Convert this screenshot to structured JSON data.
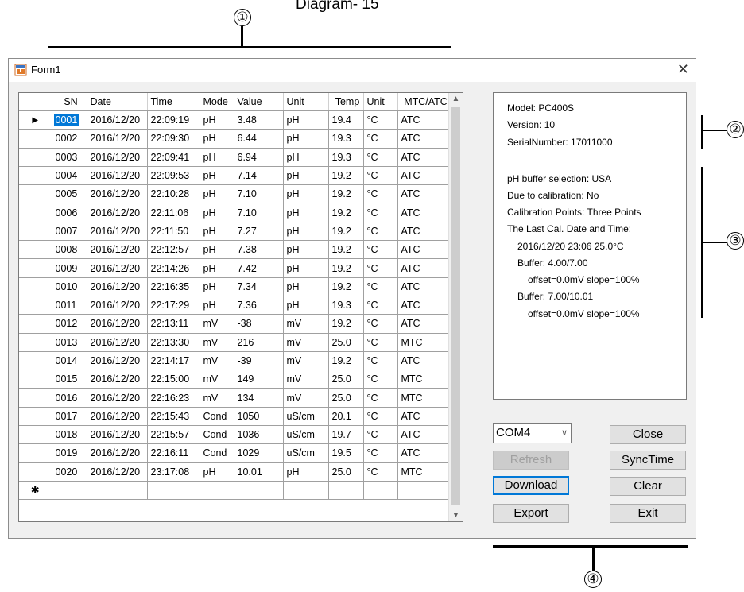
{
  "diagram": {
    "title": "Diagram- 15",
    "callouts": [
      "①",
      "②",
      "③",
      "④"
    ]
  },
  "window": {
    "title": "Form1",
    "close": "✕"
  },
  "grid": {
    "columns": [
      "SN",
      "Date",
      "Time",
      "Mode",
      "Value",
      "Unit",
      "Temp",
      "Unit",
      "MTC/ATC"
    ],
    "rows": [
      [
        "0001",
        "2016/12/20",
        "22:09:19",
        "pH",
        "3.48",
        "pH",
        "19.4",
        "°C",
        "ATC"
      ],
      [
        "0002",
        "2016/12/20",
        "22:09:30",
        "pH",
        "6.44",
        "pH",
        "19.3",
        "°C",
        "ATC"
      ],
      [
        "0003",
        "2016/12/20",
        "22:09:41",
        "pH",
        "6.94",
        "pH",
        "19.3",
        "°C",
        "ATC"
      ],
      [
        "0004",
        "2016/12/20",
        "22:09:53",
        "pH",
        "7.14",
        "pH",
        "19.2",
        "°C",
        "ATC"
      ],
      [
        "0005",
        "2016/12/20",
        "22:10:28",
        "pH",
        "7.10",
        "pH",
        "19.2",
        "°C",
        "ATC"
      ],
      [
        "0006",
        "2016/12/20",
        "22:11:06",
        "pH",
        "7.10",
        "pH",
        "19.2",
        "°C",
        "ATC"
      ],
      [
        "0007",
        "2016/12/20",
        "22:11:50",
        "pH",
        "7.27",
        "pH",
        "19.2",
        "°C",
        "ATC"
      ],
      [
        "0008",
        "2016/12/20",
        "22:12:57",
        "pH",
        "7.38",
        "pH",
        "19.2",
        "°C",
        "ATC"
      ],
      [
        "0009",
        "2016/12/20",
        "22:14:26",
        "pH",
        "7.42",
        "pH",
        "19.2",
        "°C",
        "ATC"
      ],
      [
        "0010",
        "2016/12/20",
        "22:16:35",
        "pH",
        "7.34",
        "pH",
        "19.2",
        "°C",
        "ATC"
      ],
      [
        "0011",
        "2016/12/20",
        "22:17:29",
        "pH",
        "7.36",
        "pH",
        "19.3",
        "°C",
        "ATC"
      ],
      [
        "0012",
        "2016/12/20",
        "22:13:11",
        "mV",
        "-38",
        "mV",
        "19.2",
        "°C",
        "ATC"
      ],
      [
        "0013",
        "2016/12/20",
        "22:13:30",
        "mV",
        "216",
        "mV",
        "25.0",
        "°C",
        "MTC"
      ],
      [
        "0014",
        "2016/12/20",
        "22:14:17",
        "mV",
        "-39",
        "mV",
        "19.2",
        "°C",
        "ATC"
      ],
      [
        "0015",
        "2016/12/20",
        "22:15:00",
        "mV",
        "149",
        "mV",
        "25.0",
        "°C",
        "MTC"
      ],
      [
        "0016",
        "2016/12/20",
        "22:16:23",
        "mV",
        "134",
        "mV",
        "25.0",
        "°C",
        "MTC"
      ],
      [
        "0017",
        "2016/12/20",
        "22:15:43",
        "Cond",
        "1050",
        "uS/cm",
        "20.1",
        "°C",
        "ATC"
      ],
      [
        "0018",
        "2016/12/20",
        "22:15:57",
        "Cond",
        "1036",
        "uS/cm",
        "19.7",
        "°C",
        "ATC"
      ],
      [
        "0019",
        "2016/12/20",
        "22:16:11",
        "Cond",
        "1029",
        "uS/cm",
        "19.5",
        "°C",
        "ATC"
      ],
      [
        "0020",
        "2016/12/20",
        "23:17:08",
        "pH",
        "10.01",
        "pH",
        "25.0",
        "°C",
        "MTC"
      ]
    ],
    "current_row_marker": "▶",
    "new_row_marker": "✱"
  },
  "info": {
    "model": "Model: PC400S",
    "version": "Version: 10",
    "serial": "SerialNumber: 17011000",
    "buffer_selection": "pH buffer selection: USA",
    "due_cal": "Due to calibration: No",
    "cal_points": "Calibration Points: Three Points",
    "last_cal": "The Last Cal. Date and Time:",
    "last_cal_value": "2016/12/20  23:06   25.0°C",
    "buffer1": "Buffer: 4.00/7.00",
    "buffer1_detail": "offset=0.0mV   slope=100%",
    "buffer2": "Buffer: 7.00/10.01",
    "buffer2_detail": "offset=0.0mV   slope=100%"
  },
  "controls": {
    "port_value": "COM4",
    "refresh": "Refresh",
    "download": "Download",
    "export": "Export",
    "close": "Close",
    "synctime": "SyncTime",
    "clear": "Clear",
    "exit": "Exit"
  }
}
